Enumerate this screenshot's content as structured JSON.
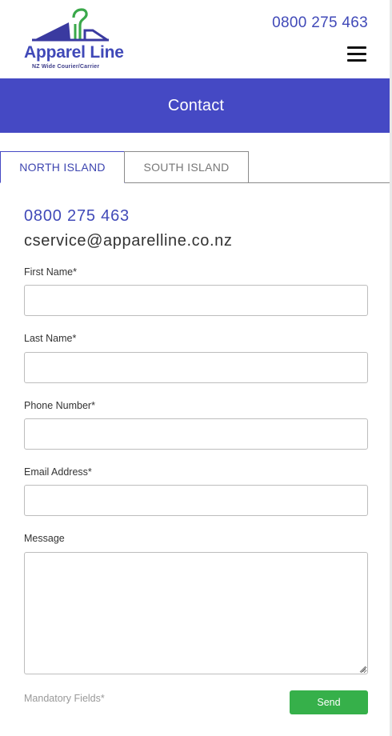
{
  "header": {
    "logo_title": "Apparel Line",
    "logo_subtitle": "NZ Wide Courier/Carrier",
    "phone": "0800 275 463",
    "menu_icon": "hamburger-menu-icon"
  },
  "banner": {
    "title": "Contact"
  },
  "tabs": [
    {
      "label": "NORTH ISLAND",
      "active": true
    },
    {
      "label": "SOUTH ISLAND",
      "active": false
    }
  ],
  "contact": {
    "phone": "0800 275 463",
    "email": "cservice@apparelline.co.nz"
  },
  "form": {
    "first_name_label": "First Name*",
    "first_name_value": "",
    "last_name_label": "Last Name*",
    "last_name_value": "",
    "phone_label": "Phone Number*",
    "phone_value": "",
    "email_label": "Email Address*",
    "email_value": "",
    "message_label": "Message",
    "message_value": "",
    "mandatory_note": "Mandatory Fields*",
    "send_label": "Send"
  },
  "colors": {
    "brand_blue": "#4549c4",
    "text_blue": "#4049b8",
    "logo_green": "#3aa84a",
    "send_green": "#36b04a"
  }
}
